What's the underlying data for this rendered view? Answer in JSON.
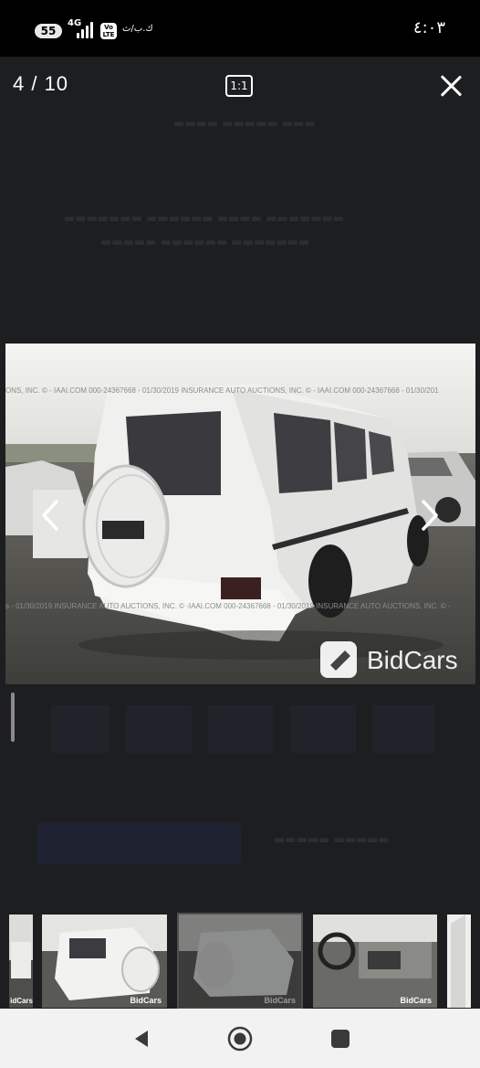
{
  "status_bar": {
    "battery": "55",
    "network": "4G",
    "volte": "Vo LTE",
    "data_rate": "ك.ب/ث",
    "time": "٤:٠٣"
  },
  "viewer": {
    "counter": "4  / 10",
    "ratio_label": "1:1"
  },
  "photo": {
    "watermark_top": "ONS, INC. © - IAAI.COM      000-24367668 - 01/30/2019 INSURANCE AUTO AUCTIONS, INC. © - IAAI.COM      000-24367668 - 01/30/201",
    "watermark_bottom": "s - 01/30/2019 INSURANCE AUTO AUCTIONS, INC. © -IAAI.COM      000-24367668 - 01/30/2019 INSURANCE AUTO AUCTIONS, INC. © -",
    "brand": "BidCars"
  },
  "thumbnails": {
    "brand": "BidCars",
    "partial_brand": "idCars"
  },
  "colors": {
    "accent": "#2b3a8f",
    "background": "#1d1e20"
  }
}
